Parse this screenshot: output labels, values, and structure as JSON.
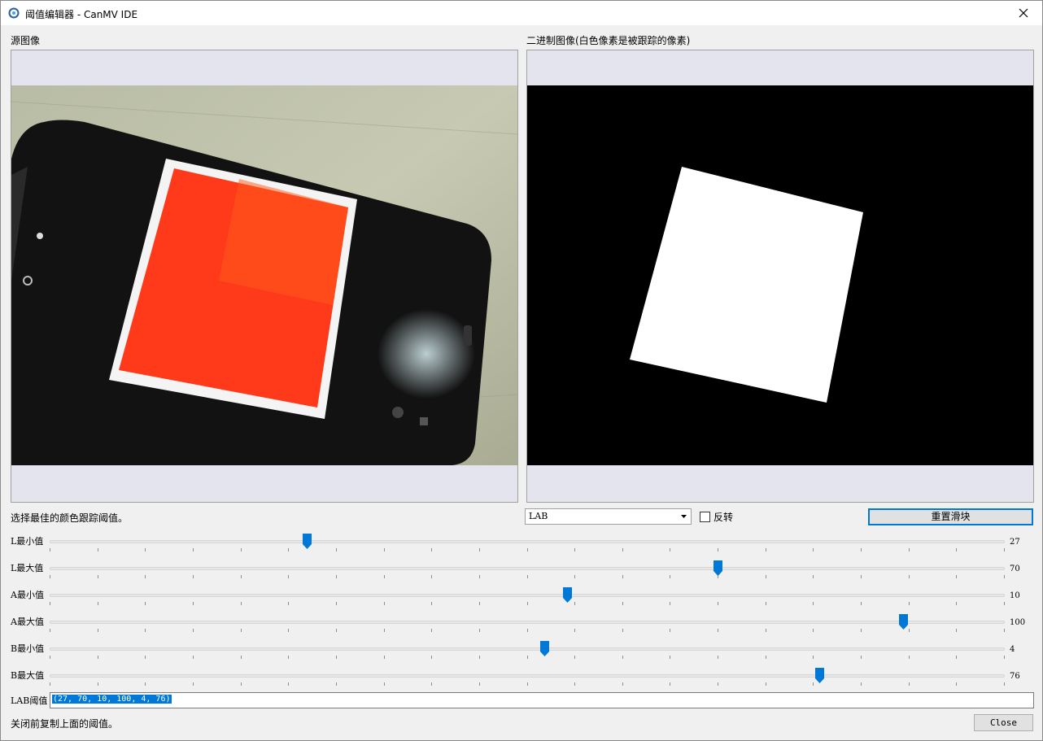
{
  "window": {
    "title": "阈值编辑器 - CanMV IDE"
  },
  "panes": {
    "source_label": "源图像",
    "binary_label": "二进制图像(白色像素是被跟踪的像素)"
  },
  "controls": {
    "hint": "选择最佳的颜色跟踪阈值。",
    "colorspace_selected": "LAB",
    "invert_label": "反转",
    "invert_checked": false,
    "reset_label": "重置滑块"
  },
  "sliders": [
    {
      "label": "L最小值",
      "value": "27",
      "fraction": 0.27
    },
    {
      "label": "L最大值",
      "value": "70",
      "fraction": 0.7
    },
    {
      "label": "A最小值",
      "value": "10",
      "fraction": 0.5423
    },
    {
      "label": "A最大值",
      "value": "100",
      "fraction": 0.8943
    },
    {
      "label": "B最小值",
      "value": "4",
      "fraction": 0.5183
    },
    {
      "label": "B最大值",
      "value": "76",
      "fraction": 0.8065
    }
  ],
  "threshold": {
    "label": "LAB阈值",
    "value": "(27, 70, 10, 100, 4, 76)"
  },
  "footer": {
    "note": "关闭前复制上面的阈值。",
    "close_label": "Close"
  },
  "colors": {
    "accent": "#0078d7",
    "pane_bg": "#e4e4ee"
  }
}
